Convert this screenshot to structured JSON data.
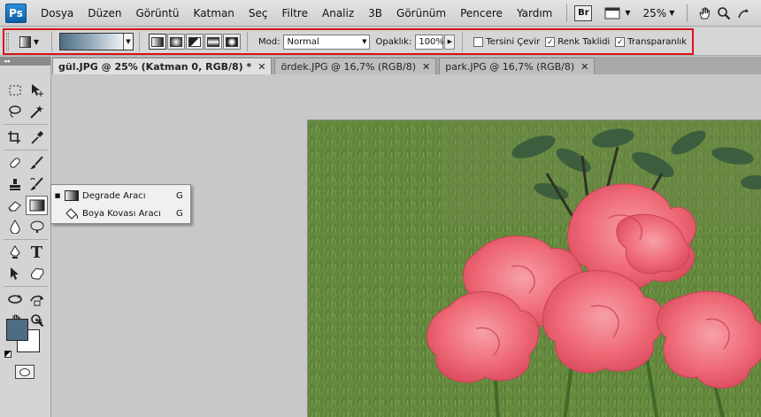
{
  "app": {
    "logo": "Ps"
  },
  "menu": [
    "Dosya",
    "Düzen",
    "Görüntü",
    "Katman",
    "Seç",
    "Filtre",
    "Analiz",
    "3B",
    "Görünüm",
    "Pencere",
    "Yardım"
  ],
  "menubar": {
    "bridge_label": "Br",
    "zoom": "25%"
  },
  "options": {
    "mode_label": "Mod:",
    "mode_value": "Normal",
    "opacity_label": "Opaklık:",
    "opacity_value": "100%",
    "reverse_label": "Tersini Çevir",
    "reverse_checked": false,
    "dither_label": "Renk Taklidi",
    "dither_checked": true,
    "transparency_label": "Transparanlık",
    "transparency_checked": true,
    "gradient_colors": [
      "#4c6d84",
      "#8ea5b6",
      "#eef2f5"
    ]
  },
  "tabs": [
    {
      "label": "gül.JPG @ 25% (Katman 0, RGB/8) *",
      "active": true
    },
    {
      "label": "ördek.JPG @ 16,7% (RGB/8)",
      "active": false
    },
    {
      "label": "park.JPG @ 16,7% (RGB/8)",
      "active": false
    }
  ],
  "flyout": [
    {
      "label": "Degrade Aracı",
      "shortcut": "G",
      "selected": true
    },
    {
      "label": "Boya Kovası Aracı",
      "shortcut": "G",
      "selected": false
    }
  ],
  "colors": {
    "foreground": "#4c6d84",
    "background": "#ffffff",
    "highlight": "#d8141c"
  },
  "toolbox": {
    "type_tool_glyph": "T"
  }
}
